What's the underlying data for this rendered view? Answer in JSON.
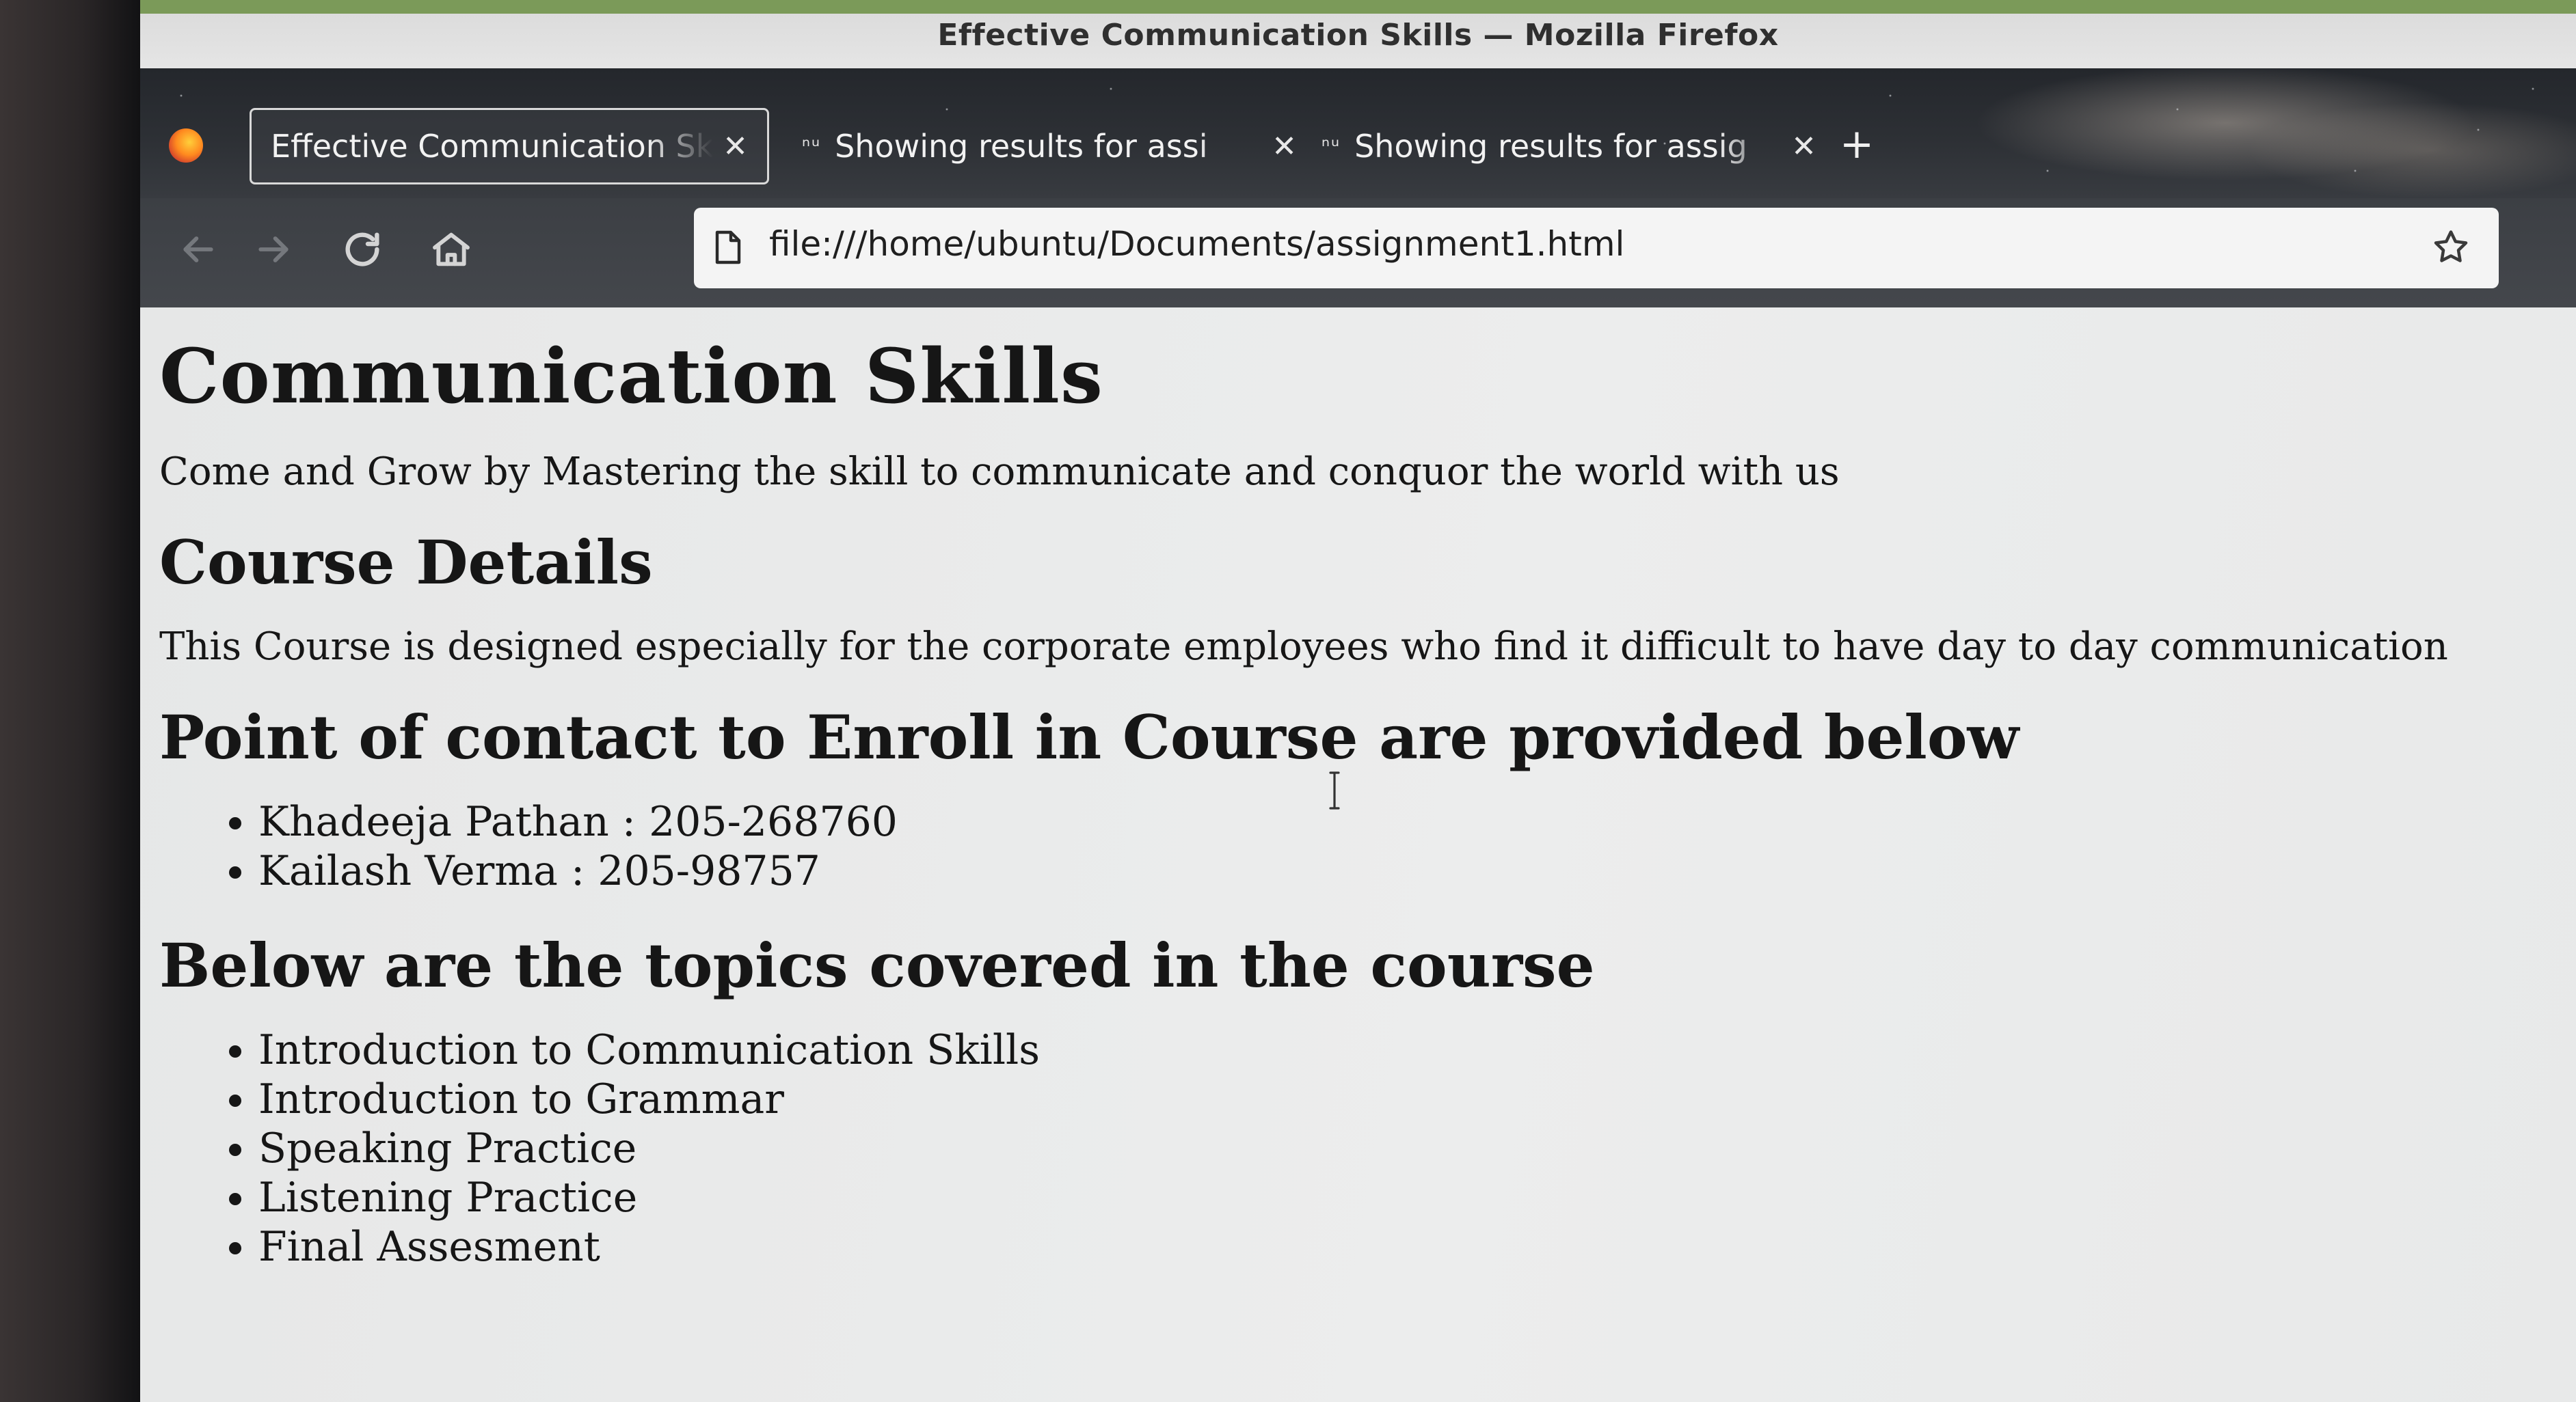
{
  "window": {
    "title": "Effective Communication Skills — Mozilla Firefox"
  },
  "tabs": [
    {
      "label": "Effective Communication Sk",
      "icon": "",
      "active": true
    },
    {
      "label": "Showing results for assi",
      "icon": "ⁿᵘ",
      "active": false
    },
    {
      "label": "Showing results for assig",
      "icon": "ⁿᵘ",
      "active": false
    }
  ],
  "navbar": {
    "url": "file:///home/ubuntu/Documents/assignment1.html",
    "back_enabled": false,
    "forward_enabled": false
  },
  "page": {
    "title": "Communication Skills",
    "tagline": "Come and Grow by Mastering the skill to communicate and conquor the world with us",
    "course_details_heading": "Course Details",
    "course_details_text": "This Course is designed especially for the corporate employees who find it difficult to have day to day communication",
    "contact_heading": "Point of contact to Enroll in Course are provided below",
    "contacts": [
      "Khadeeja Pathan : 205-268760",
      "Kailash Verma : 205-98757"
    ],
    "topics_heading": "Below are the topics covered in the course",
    "topics": [
      "Introduction to Communication Skills",
      "Introduction to Grammar",
      "Speaking Practice",
      "Listening Practice",
      "Final Assesment"
    ]
  },
  "colors": {
    "titlebar": "#e0e0e0",
    "tabstrip": "#2b2e33",
    "navbar": "#414449",
    "urlbar": "#f4f4f4",
    "page_bg": "#eaebeb",
    "text": "#161616"
  }
}
